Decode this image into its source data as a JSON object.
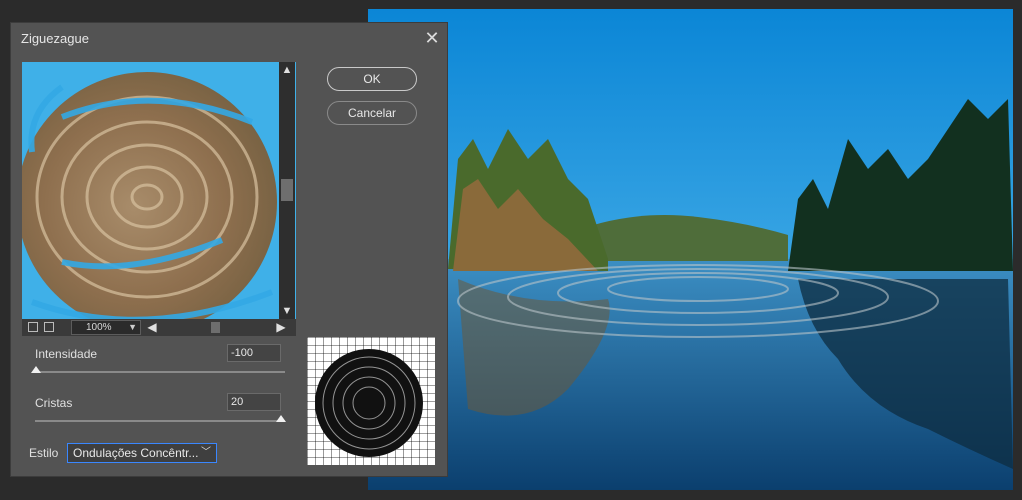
{
  "dialog": {
    "title": "Ziguezague",
    "close_icon": "close-icon"
  },
  "preview": {
    "zoom": "100%"
  },
  "buttons": {
    "ok": "OK",
    "cancel": "Cancelar"
  },
  "params": {
    "intensity_label": "Intensidade",
    "intensity_value": "-100",
    "ridges_label": "Cristas",
    "ridges_value": "20",
    "style_label": "Estilo",
    "style_value": "Ondulações Concêntr..."
  }
}
